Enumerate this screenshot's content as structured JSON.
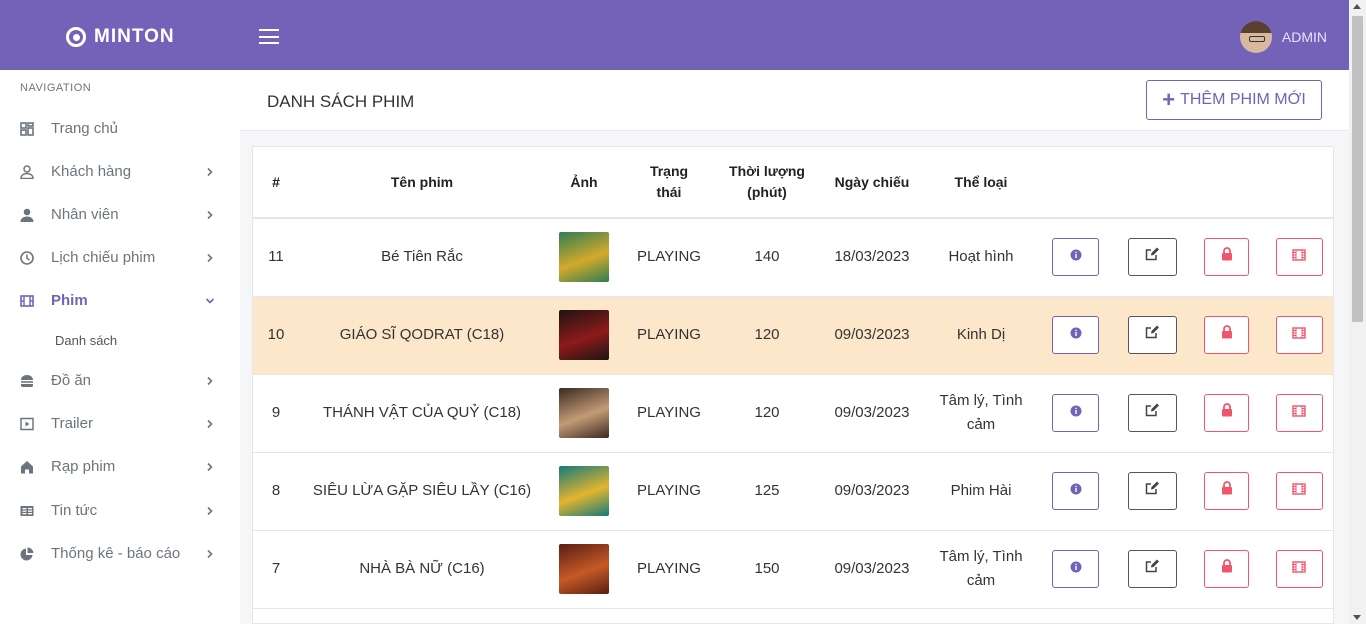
{
  "brand": {
    "name": "MINTON"
  },
  "user": {
    "name": "ADMIN"
  },
  "sidebar": {
    "section_title": "NAVIGATION",
    "items": [
      {
        "label": "Trang chủ",
        "icon": "dashboard-icon",
        "has_children": false
      },
      {
        "label": "Khách hàng",
        "icon": "user-outline-icon",
        "has_children": true
      },
      {
        "label": "Nhân viên",
        "icon": "user-icon",
        "has_children": true
      },
      {
        "label": "Lịch chiếu phim",
        "icon": "clock-icon",
        "has_children": true
      },
      {
        "label": "Phim",
        "icon": "film-icon",
        "has_children": true,
        "expanded": true
      },
      {
        "label": "Đồ ăn",
        "icon": "burger-icon",
        "has_children": true
      },
      {
        "label": "Trailer",
        "icon": "play-icon",
        "has_children": true
      },
      {
        "label": "Rạp phim",
        "icon": "home-icon",
        "has_children": true
      },
      {
        "label": "Tin tức",
        "icon": "news-icon",
        "has_children": true
      },
      {
        "label": "Thống kê - báo cáo",
        "icon": "pie-chart-icon",
        "has_children": true
      }
    ],
    "sub_items": [
      {
        "label": "Danh sách"
      }
    ]
  },
  "page": {
    "title": "DANH SÁCH PHIM",
    "add_button_label": "THÊM PHIM MỚI"
  },
  "table": {
    "headers": [
      "#",
      "Tên phim",
      "Ảnh",
      "Trạng thái",
      "Thời lượng (phút)",
      "Ngày chiếu",
      "Thể loại"
    ],
    "rows": [
      {
        "id": "11",
        "name": "Bé Tiên Rắc",
        "status": "PLAYING",
        "duration": "140",
        "date": "18/03/2023",
        "genre": "Hoạt hình",
        "poster_colors": [
          "#2e7d54",
          "#d4a92a"
        ],
        "highlight": false
      },
      {
        "id": "10",
        "name": "GIÁO SĨ QODRAT (C18)",
        "status": "PLAYING",
        "duration": "120",
        "date": "09/03/2023",
        "genre": "Kinh Dị",
        "poster_colors": [
          "#1c1414",
          "#8e1a1a"
        ],
        "highlight": true
      },
      {
        "id": "9",
        "name": "THÁNH VẬT CỦA QUỶ (C18)",
        "status": "PLAYING",
        "duration": "120",
        "date": "09/03/2023",
        "genre": "Tâm lý, Tình cảm",
        "poster_colors": [
          "#3b2a22",
          "#c49b76"
        ],
        "highlight": false
      },
      {
        "id": "8",
        "name": "SIÊU LỪA GẶP SIÊU LẦY (C16)",
        "status": "PLAYING",
        "duration": "125",
        "date": "09/03/2023",
        "genre": "Phim Hài",
        "poster_colors": [
          "#127a7a",
          "#e3b52e"
        ],
        "highlight": false
      },
      {
        "id": "7",
        "name": "NHÀ BÀ NỮ (C16)",
        "status": "PLAYING",
        "duration": "150",
        "date": "09/03/2023",
        "genre": "Tâm lý, Tình cảm",
        "poster_colors": [
          "#5a1d12",
          "#c45a26"
        ],
        "highlight": false
      }
    ]
  },
  "colors": {
    "primary": "#7262b8",
    "danger": "#f1556c",
    "highlight_row": "#fde7cb"
  }
}
